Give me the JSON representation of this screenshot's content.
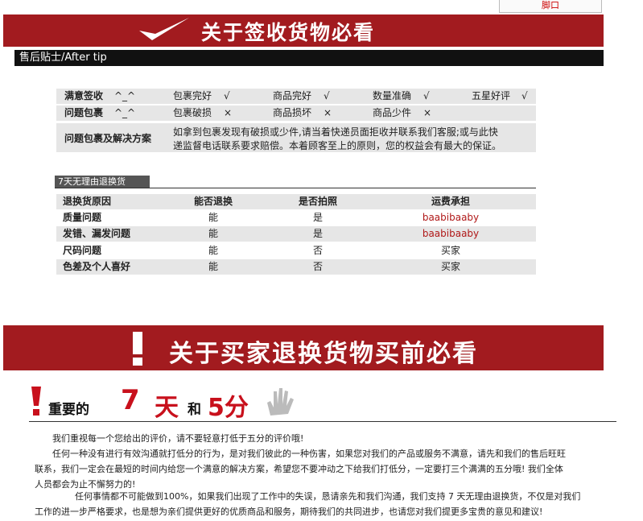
{
  "top_tab": "脚口",
  "banner1": {
    "title": "关于签收货物必看"
  },
  "after_tip": "售后贴士/After tip",
  "sign_rows": {
    "r1": {
      "label": "满意签收",
      "face": "^_^",
      "items": [
        "包裹完好",
        "商品完好",
        "数量准确",
        "五星好评"
      ],
      "mark": "√"
    },
    "r2": {
      "label": "问题包裹",
      "face": "^_^",
      "items": [
        "包裹破损",
        "商品损坏",
        "商品少件"
      ],
      "mark": "×"
    },
    "r3": {
      "label": "问题包裹及解决方案",
      "text1": "如拿到包裹发现有破损或少件,请当着快递员面拒收并联系我们客服;或与此快",
      "text2": "递监督电话联系要求赔偿。本着顾客至上的原则，您的权益会有最大的保证。"
    }
  },
  "return_tab": "7天无理由退换货",
  "table": {
    "headers": [
      "退换货原因",
      "能否退换",
      "是否拍照",
      "运费承担"
    ],
    "rows": [
      [
        "质量问题",
        "能",
        "是",
        "baabibaaby"
      ],
      [
        "发错、漏发问题",
        "能",
        "是",
        "baabibaaby"
      ],
      [
        "尺码问题",
        "能",
        "否",
        "买家"
      ],
      [
        "色差及个人喜好",
        "能",
        "否",
        "买家"
      ]
    ]
  },
  "banner2": {
    "title": "关于买家退换货物买前必看"
  },
  "important": {
    "a": "重要的",
    "b": "7",
    "c": "天",
    "d": "和",
    "e": "5分"
  },
  "paragraphs": {
    "p1": "我们重视每一个您给出的评价，请不要轻意打低于五分的评价哦!",
    "p2a": "任何一种没有进行有效沟通就打低分的行为，是对我们彼此的一种伤害，如果您对我们的产品或服务不满意，请先和我们的售后旺旺",
    "p2b": "联系，我们一定会在最短的时间内给您一个满意的解决方案，希望您不要冲动之下给我们打低分，一定要打三个满满的五分哦! 我们全体",
    "p2c": "人员都会为止不懈努力的!",
    "p3a": "任何事情都不可能做到100%，如果我们出现了工作中的失误，恳请亲先和我们沟通，我们支持 7 天无理由退换货，不仅是对我们",
    "p3b": "工作的进一步严格要求，也是想为亲们提供更好的优质商品和服务，期待我们的共同进步，也请您对我们提更多宝贵的意见和建议!"
  },
  "colors": {
    "brand_red": "#a21b1f",
    "link_red": "#b01818"
  }
}
